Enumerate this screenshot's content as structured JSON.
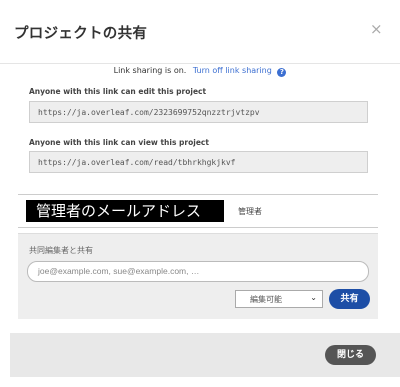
{
  "modal": {
    "title": "プロジェクトの共有",
    "close_symbol": "×"
  },
  "link_sharing": {
    "status_text": "Link sharing is on.",
    "toggle_link": "Turn off link sharing",
    "help_symbol": "?"
  },
  "edit_link": {
    "label": "Anyone with this link can edit this project",
    "url": "https://ja.overleaf.com/2323699752qnzztrjvtzpv"
  },
  "view_link": {
    "label": "Anyone with this link can view this project",
    "url": "https://ja.overleaf.com/read/tbhrkhgkjkvf"
  },
  "owner": {
    "email": "管理者のメールアドレス",
    "role": "管理者"
  },
  "share": {
    "label": "共同編集者と共有",
    "placeholder": "joe@example.com, sue@example.com, …",
    "permission_selected": "編集可能",
    "button_label": "共有"
  },
  "footer": {
    "close_label": "閉じる"
  }
}
